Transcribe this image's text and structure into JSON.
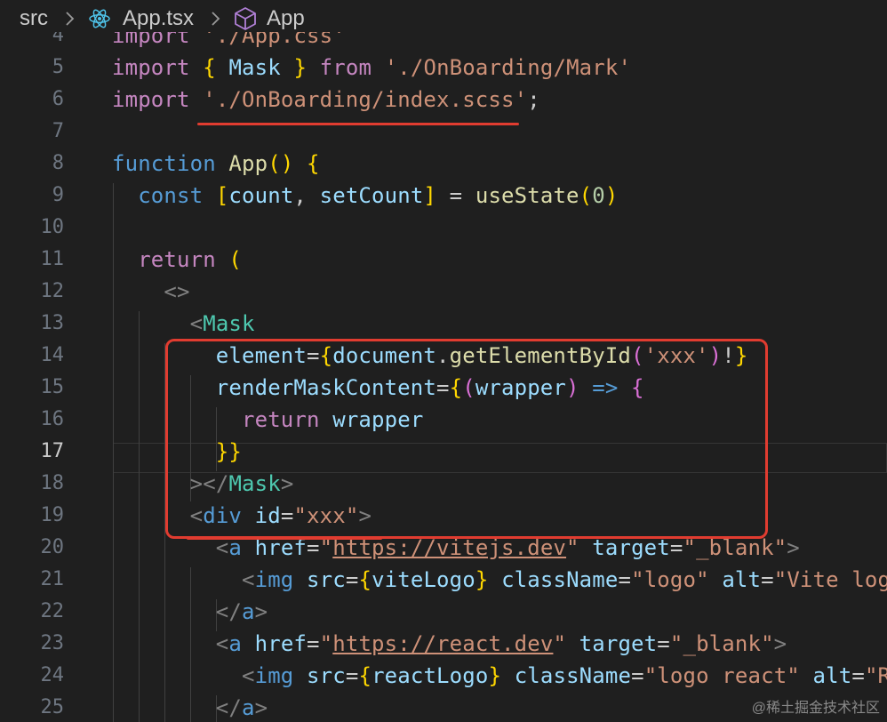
{
  "breadcrumb": {
    "folder": "src",
    "file": "App.tsx",
    "symbol": "App",
    "file_icon": "react-icon",
    "symbol_icon": "cube-icon"
  },
  "editor": {
    "active_line": "17",
    "lines": [
      {
        "n": "4",
        "text": "import './App.css'"
      },
      {
        "n": "5",
        "text": "import { Mask } from './OnBoarding/Mark'"
      },
      {
        "n": "6",
        "text": "import './OnBoarding/index.scss';"
      },
      {
        "n": "7",
        "text": ""
      },
      {
        "n": "8",
        "text": "function App() {"
      },
      {
        "n": "9",
        "text": "  const [count, setCount] = useState(0)"
      },
      {
        "n": "10",
        "text": ""
      },
      {
        "n": "11",
        "text": "  return ("
      },
      {
        "n": "12",
        "text": "    <>"
      },
      {
        "n": "13",
        "text": "      <Mask"
      },
      {
        "n": "14",
        "text": "        element={document.getElementById('xxx')!}"
      },
      {
        "n": "15",
        "text": "        renderMaskContent={(wrapper) => {"
      },
      {
        "n": "16",
        "text": "          return wrapper"
      },
      {
        "n": "17",
        "text": "        }}"
      },
      {
        "n": "18",
        "text": "      ></Mask>"
      },
      {
        "n": "19",
        "text": "      <div id=\"xxx\">"
      },
      {
        "n": "20",
        "text": "        <a href=\"https://vitejs.dev\" target=\"_blank\">"
      },
      {
        "n": "21",
        "text": "          <img src={viteLogo} className=\"logo\" alt=\"Vite logo\" />"
      },
      {
        "n": "22",
        "text": "        </a>"
      },
      {
        "n": "23",
        "text": "        <a href=\"https://react.dev\" target=\"_blank\">"
      },
      {
        "n": "24",
        "text": "          <img src={reactLogo} className=\"logo react\" alt=\"React logo\" />"
      },
      {
        "n": "25",
        "text": "        </a>"
      }
    ]
  },
  "colors": {
    "background": "#1f1f1f",
    "annotation": "#e13c30"
  },
  "watermark": "@稀土掘金技术社区"
}
